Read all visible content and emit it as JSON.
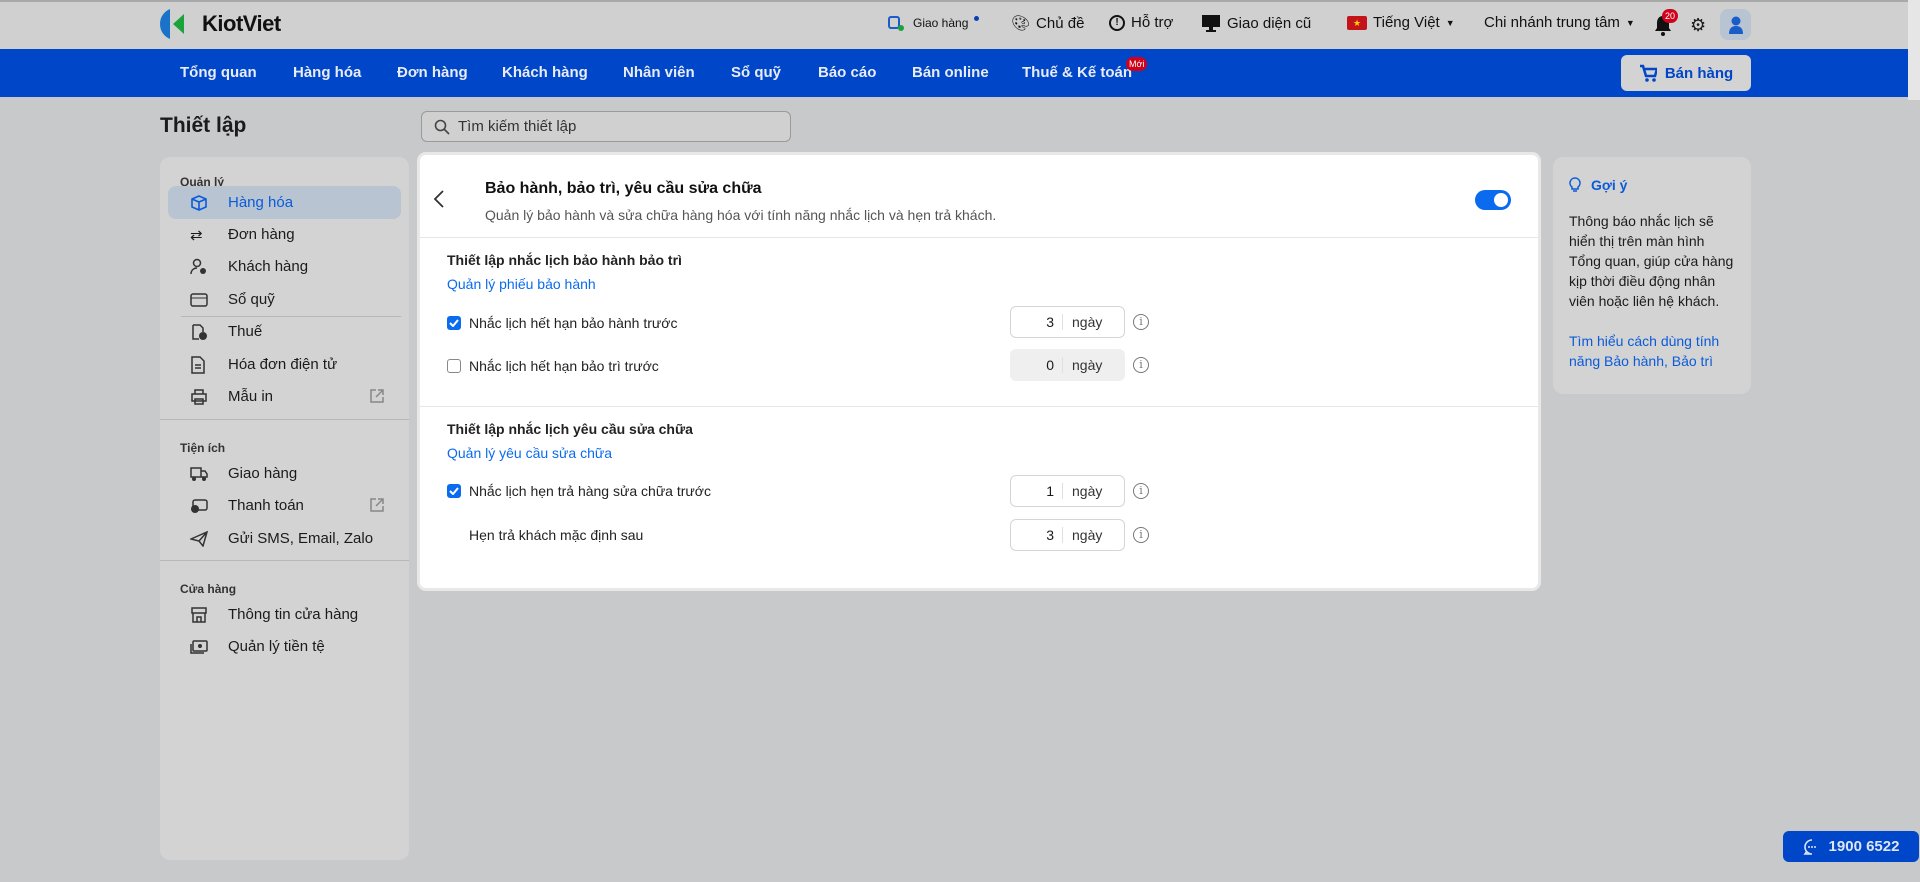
{
  "header": {
    "brand": "KiotViet",
    "delivery": "Giao hàng",
    "theme": "Chủ đề",
    "support": "Hỗ trợ",
    "old_ui": "Giao diện cũ",
    "language": "Tiếng Việt",
    "branch": "Chi nhánh trung tâm",
    "notifications": "20"
  },
  "nav": {
    "items": [
      "Tổng quan",
      "Hàng hóa",
      "Đơn hàng",
      "Khách hàng",
      "Nhân viên",
      "Sổ quỹ",
      "Báo cáo",
      "Bán online",
      "Thuế & Kế toán"
    ],
    "new_badge": "Mới",
    "sell": "Bán hàng"
  },
  "page": {
    "title": "Thiết lập",
    "search_placeholder": "Tìm kiếm thiết lập"
  },
  "sidebar": {
    "sections": [
      {
        "label": "Quản lý",
        "items": [
          "Hàng hóa",
          "Đơn hàng",
          "Khách hàng",
          "Sổ quỹ",
          "Thuế",
          "Hóa đơn điện tử",
          "Mẫu in"
        ]
      },
      {
        "label": "Tiện ích",
        "items": [
          "Giao hàng",
          "Thanh toán",
          "Gửi SMS, Email, Zalo"
        ]
      },
      {
        "label": "Cửa hàng",
        "items": [
          "Thông tin cửa hàng",
          "Quản lý tiền tệ"
        ]
      }
    ]
  },
  "card": {
    "title": "Bảo hành, bảo trì, yêu cầu sửa chữa",
    "subtitle": "Quản lý bảo hành và sửa chữa hàng hóa với tính năng nhắc lịch và hẹn trả khách.",
    "enabled": true,
    "s1": {
      "title": "Thiết lập nhắc lịch bảo hành bảo trì",
      "link": "Quản lý phiếu bảo hành",
      "r1": {
        "label": "Nhắc lịch hết hạn bảo hành trước",
        "value": "3",
        "unit": "ngày",
        "checked": true
      },
      "r2": {
        "label": "Nhắc lịch hết hạn bảo trì trước",
        "value": "0",
        "unit": "ngày",
        "checked": false
      }
    },
    "s2": {
      "title": "Thiết lập nhắc lịch yêu cầu sửa chữa",
      "link": "Quản lý yêu cầu sửa chữa",
      "r1": {
        "label": "Nhắc lịch hẹn trả hàng sửa chữa trước",
        "value": "1",
        "unit": "ngày",
        "checked": true
      },
      "r2": {
        "label": "Hẹn trả khách mặc định sau",
        "value": "3",
        "unit": "ngày"
      }
    }
  },
  "hint": {
    "title": "Gợi ý",
    "body": "Thông báo nhắc lịch sẽ hiển thị trên màn hình Tổng quan, giúp cửa hàng kịp thời điều động nhân viên hoặc liên hệ khách.",
    "link": "Tìm hiểu cách dùng tính năng Bảo hành, Bảo trì"
  },
  "hotline": "1900 6522",
  "colors": {
    "brand": "#0046c8",
    "accent": "#0b6bef"
  }
}
